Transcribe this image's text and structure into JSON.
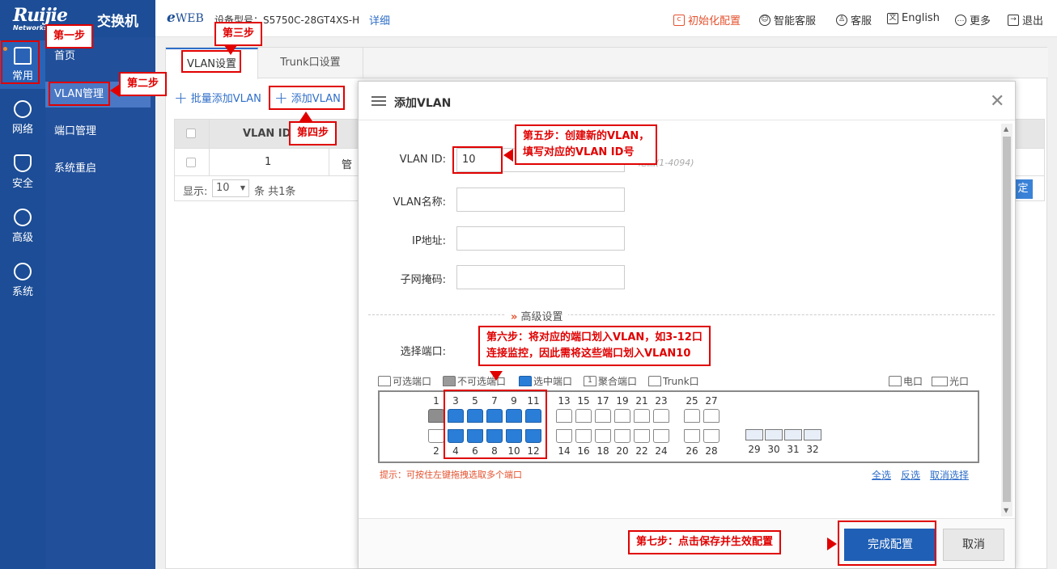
{
  "header": {
    "brand": "Ruijie",
    "brand_sub": "Networks",
    "product": "交换机",
    "eweb_e": "e",
    "eweb_rest": "WEB",
    "model": "设备型号：S5750C-28GT4XS-H",
    "detail": "详细",
    "actions": [
      {
        "label": "初始化配置",
        "icon": "init-config-icon"
      },
      {
        "label": "智能客服",
        "icon": "smart-service-icon"
      },
      {
        "label": "客服",
        "icon": "user-icon"
      },
      {
        "label": "English",
        "icon": "language-icon"
      },
      {
        "label": "更多",
        "icon": "more-icon"
      },
      {
        "label": "退出",
        "icon": "logout-icon"
      }
    ]
  },
  "leftnav": [
    {
      "label": "常用",
      "icon": "home-icon"
    },
    {
      "label": "网络",
      "icon": "network-icon"
    },
    {
      "label": "安全",
      "icon": "shield-icon"
    },
    {
      "label": "高级",
      "icon": "advanced-user-icon"
    },
    {
      "label": "系统",
      "icon": "gear-icon"
    }
  ],
  "subnav": [
    "首页",
    "VLAN管理",
    "端口管理",
    "系统重启"
  ],
  "tabs": [
    "VLAN设置",
    "Trunk口设置"
  ],
  "toolbar": {
    "batch_add": "批量添加VLAN",
    "add": "添加VLAN"
  },
  "table": {
    "col_vlan_id": "VLAN ID",
    "row1_id": "1",
    "row1_name": "管",
    "footer_show": "显示:",
    "page_size": "10",
    "footer_count": "条 共1条",
    "right_btn": "定"
  },
  "modal": {
    "title": "添加VLAN",
    "close": "✕",
    "vlan_id_label": "VLAN ID:",
    "vlan_id_value": "10",
    "vlan_id_hint": "范围(1-4094)",
    "vlan_name_label": "VLAN名称:",
    "ip_label": "IP地址:",
    "mask_label": "子网掩码:",
    "advanced": "高级设置",
    "advanced_arrow": "»",
    "select_port_label": "选择端口:",
    "legend": {
      "available": "可选端口",
      "unavailable": "不可选端口",
      "selected": "选中端口",
      "aggregate": "聚合端口",
      "aggregate_num": "1",
      "trunk": "Trunk口",
      "electrical": "电口",
      "optical": "光口"
    },
    "ports_top": [
      "1",
      "3",
      "5",
      "7",
      "9",
      "11",
      "13",
      "15",
      "17",
      "19",
      "21",
      "23",
      "25",
      "27"
    ],
    "ports_bottom": [
      "2",
      "4",
      "6",
      "8",
      "10",
      "12",
      "14",
      "16",
      "18",
      "20",
      "22",
      "24",
      "26",
      "28"
    ],
    "fiber_ports": [
      "29",
      "30",
      "31",
      "32"
    ],
    "tip": "提示：可按住左键拖拽选取多个端口",
    "select_all": "全选",
    "invert": "反选",
    "clear": "取消选择",
    "confirm": "完成配置",
    "cancel": "取消"
  },
  "annotations": {
    "step1": "第一步",
    "step2": "第二步",
    "step3": "第三步",
    "step4": "第四步",
    "step5_line1": "第五步：创建新的VLAN，",
    "step5_line2": "填写对应的VLAN ID号",
    "step6_line1": "第六步：将对应的端口划入VLAN，如3-12口",
    "step6_line2": "连接监控，因此需将这些端口划入VLAN10",
    "step7": "第七步：点击保存并生效配置"
  },
  "colors": {
    "nav_blue": "#1c4d96",
    "accent_blue": "#2f6ec8",
    "selected_port": "#2a7ed8",
    "annotation_red": "#e00000",
    "orange": "#e4522f"
  }
}
